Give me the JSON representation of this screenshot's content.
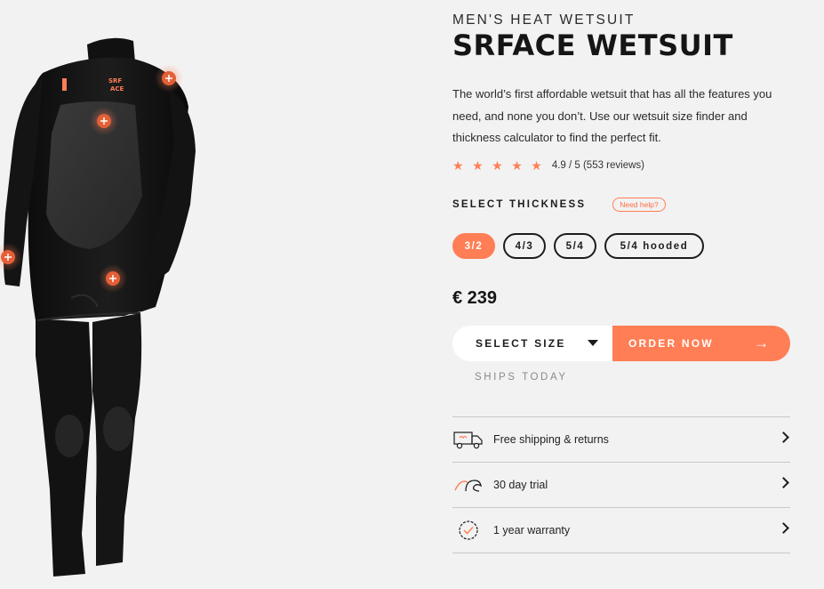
{
  "product": {
    "category": "MEN'S HEAT WETSUIT",
    "title": "SRFACE WETSUIT",
    "description": "The world’s first affordable wetsuit that has all the features you need, and none you don’t. Use our wetsuit size finder and thickness calculator to find the perfect fit.",
    "rating": {
      "stars": 5,
      "star_color": "#ff7e55",
      "text": "4.9 / 5 (553 reviews)"
    },
    "price": "€ 239",
    "image": {
      "icon": "wetsuit-image",
      "hotspot_icon": "plus-icon",
      "accent": "#ff7e55"
    }
  },
  "thickness": {
    "label": "SELECT THICKNESS",
    "help_label": "Need help?",
    "options": [
      {
        "label": "3/2",
        "selected": true
      },
      {
        "label": "4/3",
        "selected": false
      },
      {
        "label": "5/4",
        "selected": false
      },
      {
        "label": "5/4 hooded",
        "selected": false
      }
    ]
  },
  "purchase": {
    "size_label": "SELECT SIZE",
    "order_label": "ORDER NOW",
    "order_arrow": "→",
    "ships_text": "SHIPS TODAY"
  },
  "features": [
    {
      "label": "Free shipping & returns",
      "icon": "truck-icon"
    },
    {
      "label": "30 day trial",
      "icon": "wave-icon"
    },
    {
      "label": "1 year warranty",
      "icon": "badge-check-icon"
    }
  ],
  "colors": {
    "accent": "#ff7e55",
    "background": "#f2f2f2",
    "text": "#1c1c1c"
  }
}
